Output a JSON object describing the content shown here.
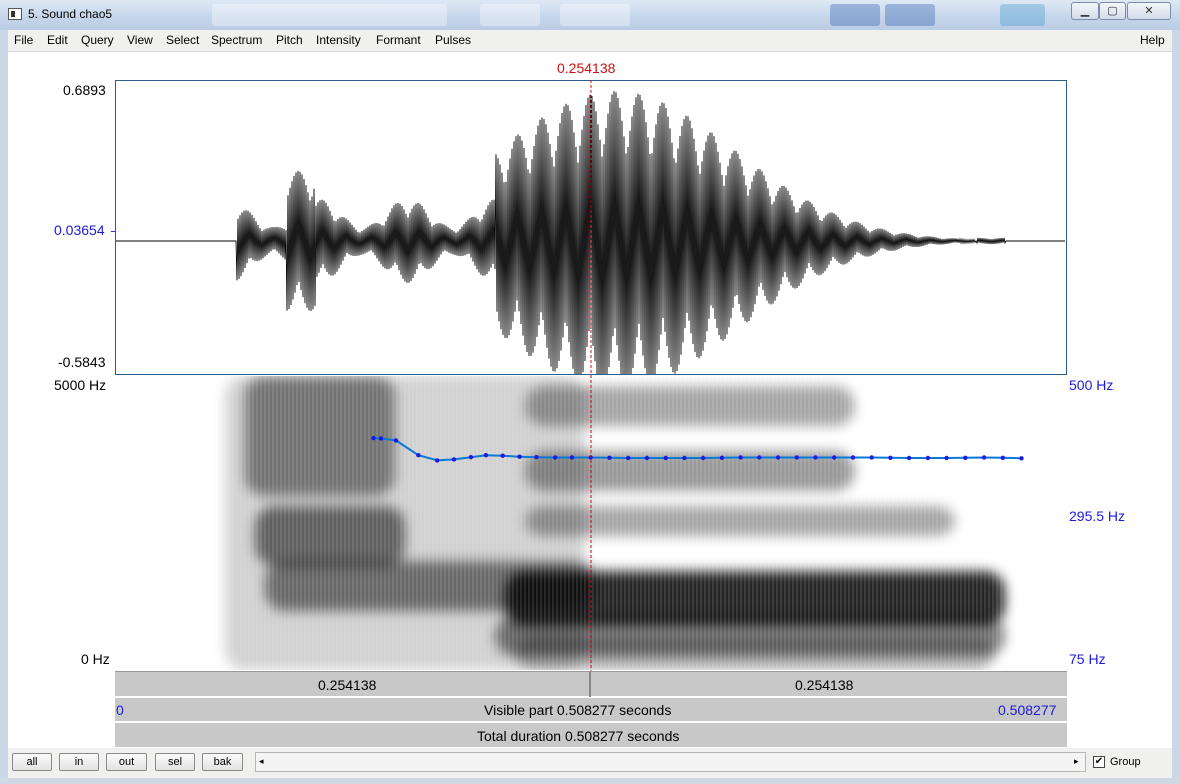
{
  "window": {
    "title": "5. Sound chao5"
  },
  "menu": [
    "File",
    "Edit",
    "Query",
    "View",
    "Select",
    "Spectrum",
    "Pitch",
    "Intensity",
    "Formant",
    "Pulses"
  ],
  "menu_help": "Help",
  "cursor": {
    "time_label": "0.254138",
    "time": 0.254138
  },
  "waveform": {
    "max_label": "0.6893",
    "zero_label": "0.03654",
    "min_label": "-0.5843"
  },
  "spectrogram": {
    "freq_max_label": "5000 Hz",
    "freq_min_label": "0 Hz"
  },
  "pitch": {
    "top_label": "500 Hz",
    "value_label": "295.5 Hz",
    "bottom_label": "75 Hz",
    "points": [
      [
        0.138,
        335
      ],
      [
        0.142,
        334
      ],
      [
        0.15,
        330
      ],
      [
        0.162,
        300
      ],
      [
        0.172,
        290
      ],
      [
        0.181,
        292
      ],
      [
        0.19,
        296
      ],
      [
        0.198,
        300
      ],
      [
        0.207,
        299
      ],
      [
        0.216,
        297
      ],
      [
        0.225,
        296
      ],
      [
        0.235,
        295.5
      ],
      [
        0.244,
        295.5
      ],
      [
        0.254,
        295.5
      ],
      [
        0.264,
        295
      ],
      [
        0.274,
        294.5
      ],
      [
        0.284,
        294.5
      ],
      [
        0.294,
        294.5
      ],
      [
        0.304,
        294.5
      ],
      [
        0.314,
        294.5
      ],
      [
        0.324,
        295
      ],
      [
        0.334,
        295.5
      ],
      [
        0.344,
        295.5
      ],
      [
        0.354,
        295.5
      ],
      [
        0.364,
        295.5
      ],
      [
        0.374,
        295.5
      ],
      [
        0.384,
        295.5
      ],
      [
        0.394,
        295.5
      ],
      [
        0.404,
        295.5
      ],
      [
        0.414,
        295
      ],
      [
        0.424,
        294.5
      ],
      [
        0.434,
        294.5
      ],
      [
        0.444,
        294.5
      ],
      [
        0.454,
        295
      ],
      [
        0.464,
        295.5
      ],
      [
        0.474,
        295
      ],
      [
        0.484,
        294
      ]
    ]
  },
  "selection": {
    "left_label": "0.254138",
    "right_label": "0.254138"
  },
  "visible": {
    "start_label": "0",
    "text": "Visible part 0.508277 seconds",
    "end_label": "0.508277"
  },
  "total": {
    "text": "Total duration 0.508277 seconds"
  },
  "toolbar": {
    "all": "all",
    "in": "in",
    "out": "out",
    "sel": "sel",
    "bak": "bak",
    "group_label": "Group",
    "group_checked": true
  },
  "colors": {
    "cursor": "#cc1010",
    "axis_blue": "#1a1ae0",
    "pitch_line": "#0a78d8"
  },
  "icons": {
    "scroll_left": "◂",
    "scroll_right": "▸",
    "check": "✔"
  }
}
